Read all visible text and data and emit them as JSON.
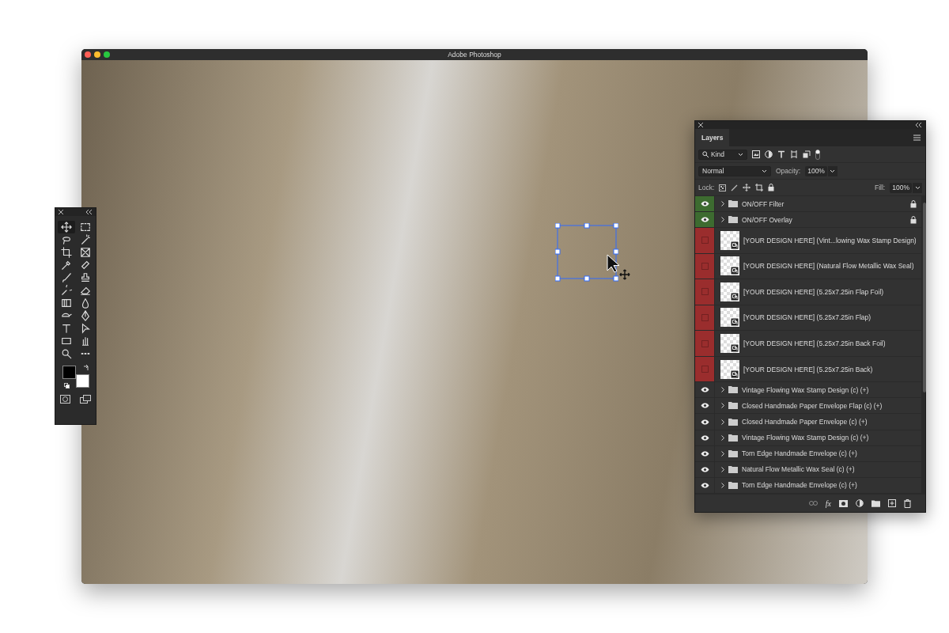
{
  "window": {
    "title": "Adobe Photoshop"
  },
  "tools": [
    {
      "kind": "move",
      "selected": true
    },
    {
      "kind": "marquee",
      "selected": false
    },
    {
      "kind": "lasso",
      "selected": false
    },
    {
      "kind": "wand",
      "selected": false
    },
    {
      "kind": "crop",
      "selected": false
    },
    {
      "kind": "frame",
      "selected": false
    },
    {
      "kind": "eyedropper",
      "selected": false
    },
    {
      "kind": "healing",
      "selected": false
    },
    {
      "kind": "brush",
      "selected": false
    },
    {
      "kind": "stamp",
      "selected": false
    },
    {
      "kind": "history",
      "selected": false
    },
    {
      "kind": "eraser",
      "selected": false
    },
    {
      "kind": "gradient",
      "selected": false
    },
    {
      "kind": "blur",
      "selected": false
    },
    {
      "kind": "dodge",
      "selected": false
    },
    {
      "kind": "pen",
      "selected": false
    },
    {
      "kind": "type",
      "selected": false
    },
    {
      "kind": "pathselect",
      "selected": false
    },
    {
      "kind": "rectangle",
      "selected": false
    },
    {
      "kind": "hand",
      "selected": false
    },
    {
      "kind": "zoom",
      "selected": false
    },
    {
      "kind": "more",
      "selected": false
    }
  ],
  "swatches": [
    {
      "kind": "foreground",
      "color": "#000000"
    },
    {
      "kind": "background",
      "color": "#ffffff"
    }
  ],
  "layers_panel": {
    "tab": "Layers",
    "filter": "Kind",
    "blend_mode": "Normal",
    "opacity_label": "Opacity:",
    "opacity": "100%",
    "lock_label": "Lock:",
    "fill_label": "Fill:",
    "fill": "100%",
    "fx_label": "fx",
    "layers": [
      {
        "kind": "group",
        "name": "ON/OFF Filter",
        "visible": true,
        "locked": true,
        "color": "#3d6b30"
      },
      {
        "kind": "group",
        "name": "ON/OFF Overlay",
        "visible": true,
        "locked": true,
        "color": "#3d6b30"
      },
      {
        "kind": "smart",
        "name": "[YOUR DESIGN HERE] (Vint...lowing Wax Stamp Design)",
        "visible": false,
        "locked": false,
        "color": "#9a2d2d"
      },
      {
        "kind": "smart",
        "name": "[YOUR DESIGN HERE] (Natural Flow Metallic Wax Seal)",
        "visible": false,
        "locked": false,
        "color": "#9a2d2d"
      },
      {
        "kind": "smart",
        "name": "[YOUR DESIGN HERE] (5.25x7.25in Flap Foil)",
        "visible": false,
        "locked": false,
        "color": "#9a2d2d"
      },
      {
        "kind": "smart",
        "name": "[YOUR DESIGN HERE] (5.25x7.25in Flap)",
        "visible": false,
        "locked": false,
        "color": "#9a2d2d"
      },
      {
        "kind": "smart",
        "name": "[YOUR DESIGN HERE] (5.25x7.25in Back Foil)",
        "visible": false,
        "locked": false,
        "color": "#9a2d2d"
      },
      {
        "kind": "smart",
        "name": "[YOUR DESIGN HERE] (5.25x7.25in Back)",
        "visible": false,
        "locked": false,
        "color": "#9a2d2d"
      },
      {
        "kind": "group",
        "name": "Vintage Flowing Wax Stamp Design (c) (+)",
        "visible": true,
        "locked": false
      },
      {
        "kind": "group",
        "name": "Closed Handmade Paper Envelope Flap (c) (+)",
        "visible": true,
        "locked": false
      },
      {
        "kind": "group",
        "name": "Closed Handmade Paper Envelope (c) (+)",
        "visible": true,
        "locked": false
      },
      {
        "kind": "group",
        "name": "Vintage Flowing Wax Stamp Design (c) (+)",
        "visible": true,
        "locked": false
      },
      {
        "kind": "group",
        "name": "Torn Edge Handmade Envelope (c) (+)",
        "visible": true,
        "locked": false
      },
      {
        "kind": "group",
        "name": "Natural Flow Metallic Wax Seal (c) (+)",
        "visible": true,
        "locked": false
      },
      {
        "kind": "group",
        "name": "Torn Edge Handmade Envelope (c) (+)",
        "visible": true,
        "locked": false
      }
    ]
  }
}
